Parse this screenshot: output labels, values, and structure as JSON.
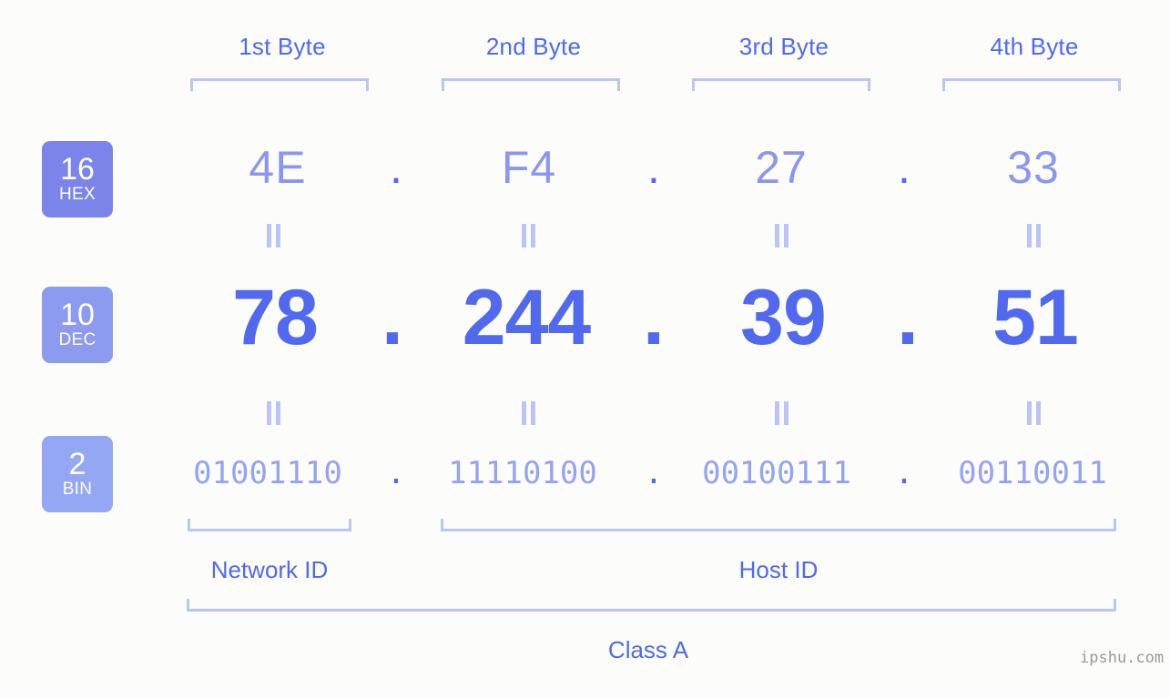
{
  "bytes": [
    {
      "label": "1st Byte"
    },
    {
      "label": "2nd Byte"
    },
    {
      "label": "3rd Byte"
    },
    {
      "label": "4th Byte"
    }
  ],
  "rows": {
    "hex": {
      "badge_num": "16",
      "badge_name": "HEX",
      "values": [
        "4E",
        "F4",
        "27",
        "33"
      ],
      "separator": "."
    },
    "dec": {
      "badge_num": "10",
      "badge_name": "DEC",
      "values": [
        "78",
        "244",
        "39",
        "51"
      ],
      "separator": "."
    },
    "bin": {
      "badge_num": "2",
      "badge_name": "BIN",
      "values": [
        "01001110",
        "11110100",
        "00100111",
        "00110011"
      ],
      "separator": "."
    }
  },
  "segments": {
    "network_id": "Network ID",
    "host_id": "Host ID",
    "class": "Class A"
  },
  "watermark": "ipshu.com",
  "colors": {
    "background": "#FCFDFA",
    "accent": "#5069EE",
    "hex_text": "#8A96F0",
    "bin_text": "#94A3F2",
    "bracket": "#BAC4F8",
    "badge_hex": "#7B84E8",
    "badge_dec": "#8C9AF0",
    "badge_bin": "#93A7F5"
  }
}
